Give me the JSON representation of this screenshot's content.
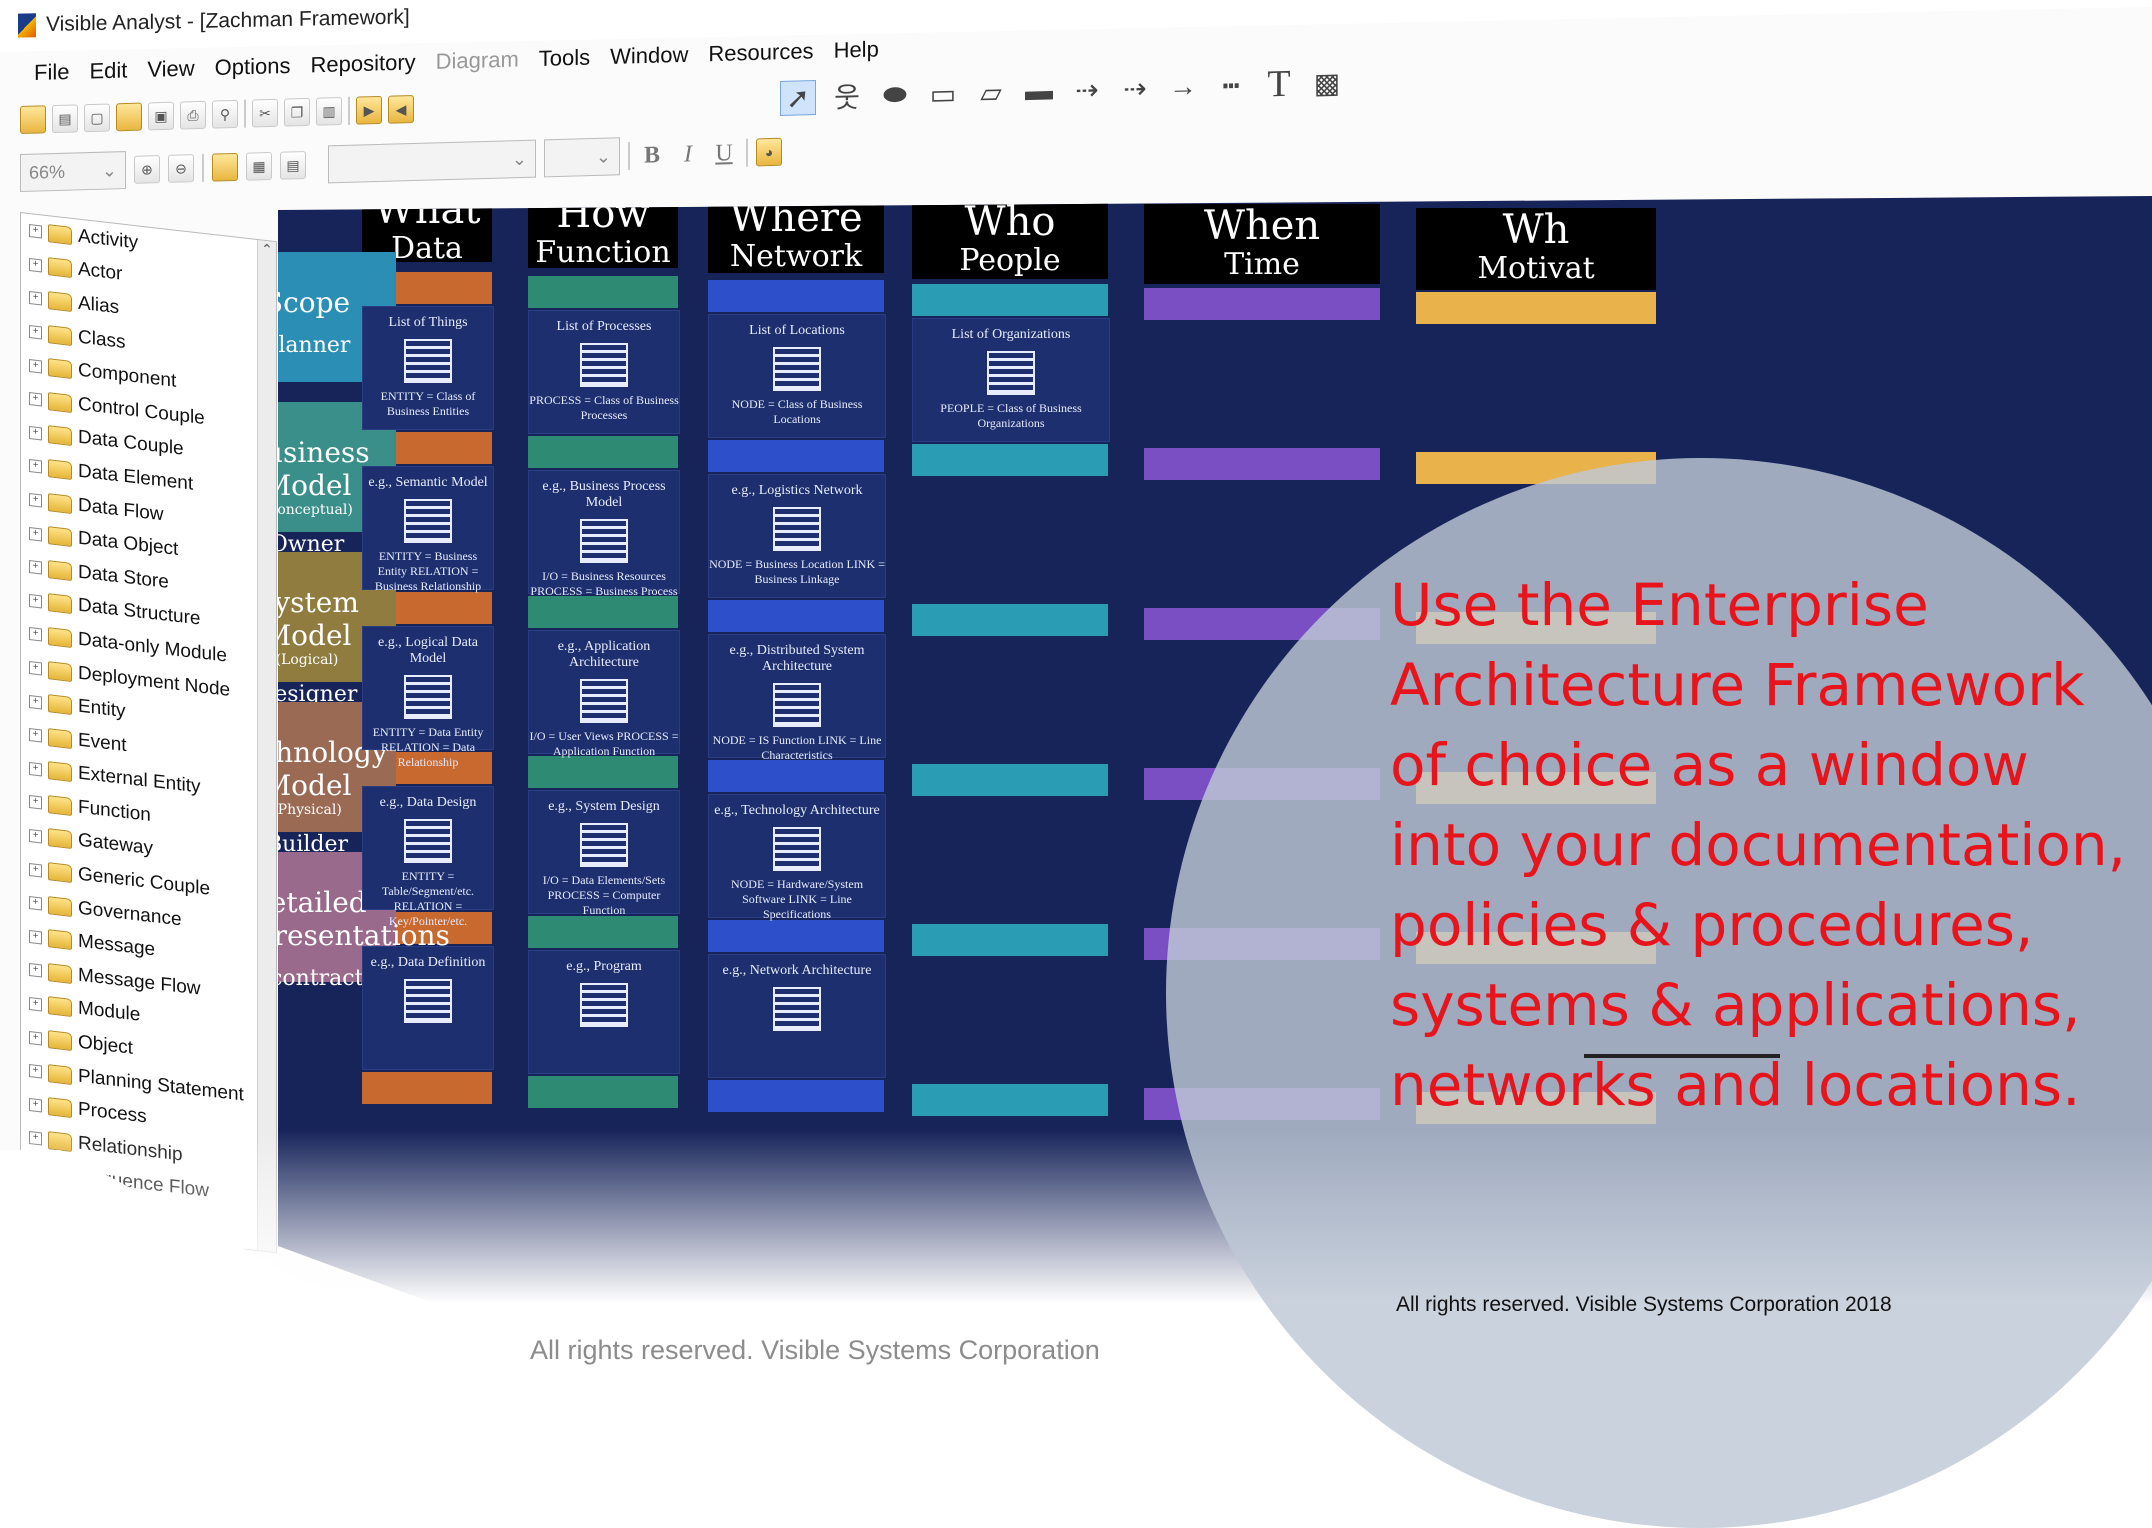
{
  "window": {
    "title": "Visible Analyst - [Zachman Framework]"
  },
  "menu": [
    "File",
    "Edit",
    "View",
    "Options",
    "Repository",
    "Diagram",
    "Tools",
    "Window",
    "Resources",
    "Help"
  ],
  "menu_disabled": [
    "Diagram"
  ],
  "zoom": {
    "value": "66%"
  },
  "format": {
    "bold": "B",
    "italic": "I",
    "underline": "U"
  },
  "tree": {
    "items": [
      "Activity",
      "Actor",
      "Alias",
      "Class",
      "Component",
      "Control Couple",
      "Data Couple",
      "Data Element",
      "Data Flow",
      "Data Object",
      "Data Store",
      "Data Structure",
      "Data-only Module",
      "Deployment Node",
      "Entity",
      "Event",
      "External Entity",
      "Function",
      "Gateway",
      "Generic Couple",
      "Governance",
      "Message",
      "Message Flow",
      "Module",
      "Object",
      "Planning Statement",
      "Process",
      "Relationship",
      "Sequence Flow"
    ]
  },
  "diagram": {
    "columns": [
      {
        "h1": "What",
        "h2": "Data",
        "color": "#c8692f"
      },
      {
        "h1": "How",
        "h2": "Function",
        "color": "#2f8a73"
      },
      {
        "h1": "Where",
        "h2": "Network",
        "color": "#2d4fc9"
      },
      {
        "h1": "Who",
        "h2": "People",
        "color": "#2a9db4"
      },
      {
        "h1": "When",
        "h2": "Time",
        "color": "#7a4fc4"
      },
      {
        "h1": "Wh",
        "h2": "Motivat",
        "color": "#e9b24a"
      }
    ],
    "rows": [
      {
        "t1": "Scope",
        "t2": "",
        "t3": "Planner",
        "color": "#2b8fb5"
      },
      {
        "t1": "Business Model",
        "t2": "(Conceptual)",
        "t3": "Owner",
        "color": "#3a8f8a"
      },
      {
        "t1": "System Model",
        "t2": "(Logical)",
        "t3": "Designer",
        "color": "#8f7c3e"
      },
      {
        "t1": "Technology Model",
        "t2": "(Physical)",
        "t3": "Builder",
        "color": "#9a6a54"
      },
      {
        "t1": "Detailed Representations",
        "t2": "",
        "t3": "Subcontractor",
        "color": "#9a6a8c"
      }
    ],
    "cells": [
      [
        {
          "title": "List of Things",
          "desc": "ENTITY = Class of Business Entities"
        },
        {
          "title": "List of Processes",
          "desc": "PROCESS = Class of Business Processes"
        },
        {
          "title": "List of Locations",
          "desc": "NODE = Class of Business Locations"
        },
        {
          "title": "List of Organizations",
          "desc": "PEOPLE = Class of Business Organizations"
        }
      ],
      [
        {
          "title": "e.g., Semantic Model",
          "desc": "ENTITY = Business Entity RELATION = Business Relationship"
        },
        {
          "title": "e.g., Business Process Model",
          "desc": "I/O = Business Resources PROCESS = Business Process"
        },
        {
          "title": "e.g., Logistics Network",
          "desc": "NODE = Business Location LINK = Business Linkage"
        }
      ],
      [
        {
          "title": "e.g., Logical Data Model",
          "desc": "ENTITY = Data Entity RELATION = Data Relationship"
        },
        {
          "title": "e.g., Application Architecture",
          "desc": "I/O = User Views PROCESS = Application Function"
        },
        {
          "title": "e.g., Distributed System Architecture",
          "desc": "NODE = IS Function LINK = Line Characteristics"
        }
      ],
      [
        {
          "title": "e.g., Data Design",
          "desc": "ENTITY = Table/Segment/etc. RELATION = Key/Pointer/etc."
        },
        {
          "title": "e.g., System Design",
          "desc": "I/O = Data Elements/Sets PROCESS = Computer Function"
        },
        {
          "title": "e.g., Technology Architecture",
          "desc": "NODE = Hardware/System Software LINK = Line Specifications"
        }
      ],
      [
        {
          "title": "e.g., Data Definition",
          "desc": ""
        },
        {
          "title": "e.g., Program",
          "desc": ""
        },
        {
          "title": "e.g., Network Architecture",
          "desc": ""
        }
      ]
    ]
  },
  "overlay": {
    "text": "Use the Enterprise Architecture Framework of choice as a window into your documentation, policies & procedures, systems & applications, networks and locations.",
    "color": "#e8141c"
  },
  "footer": {
    "copyright_right": "All rights reserved.  Visible Systems Corporation 2018",
    "copyright_left": "All rights reserved. Visible Systems Corporation"
  }
}
